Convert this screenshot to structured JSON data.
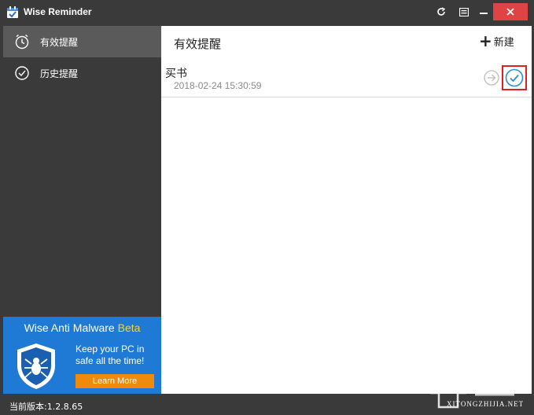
{
  "app": {
    "title": "Wise Reminder"
  },
  "titlebar": {
    "refresh_icon": "refresh-icon",
    "menu_icon": "menu-icon",
    "minimize_icon": "minimize-icon",
    "close_icon": "close-icon",
    "close_color": "#e04343"
  },
  "sidebar": {
    "items": [
      {
        "label": "有效提醒",
        "icon": "clock-icon",
        "active": true
      },
      {
        "label": "历史提醒",
        "icon": "check-circle-icon",
        "active": false
      }
    ]
  },
  "ad": {
    "title": "Wise Anti Malware",
    "badge": "Beta",
    "text": "Keep your PC in safe all the time!",
    "button": "Learn More",
    "bg_color": "#1f7ad6",
    "button_color": "#f08a0c"
  },
  "main": {
    "title": "有效提醒",
    "new_label": "新建",
    "reminders": [
      {
        "name": "买书",
        "time": "2018-02-24 15:30:59"
      }
    ]
  },
  "status": {
    "version": "当前版本:1.2.8.65"
  },
  "watermark": {
    "text": "XITONGZHIJIA.NET"
  }
}
